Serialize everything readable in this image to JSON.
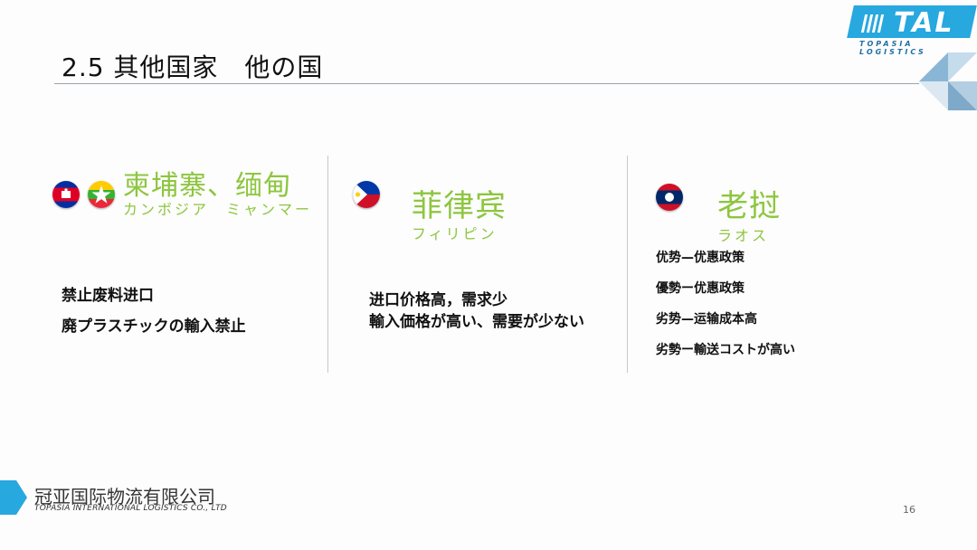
{
  "slide": {
    "title": "2.5 其他国家　他の国",
    "page_number": "16"
  },
  "logo": {
    "text": "TAL",
    "subtext": "TOPASIA LOGISTICS"
  },
  "columns": [
    {
      "heading_cn": "柬埔寨、缅甸",
      "heading_jp": "カンボジア　ミャンマー",
      "flags": [
        "cambodia-flag-icon",
        "myanmar-flag-icon"
      ],
      "lines": [
        "禁止废料进口",
        "廃プラスチックの輸入禁止"
      ]
    },
    {
      "heading_cn": "菲律宾",
      "heading_jp": "フィリピン",
      "flags": [
        "philippines-flag-icon"
      ],
      "lines": [
        "进口价格高，需求少",
        "輸入価格が高い、需要が少ない"
      ]
    },
    {
      "heading_cn": "老挝",
      "heading_jp": "ラオス",
      "flags": [
        "laos-flag-icon"
      ],
      "lines": [
        "优势—优惠政策",
        "優勢ー优惠政策",
        "劣势—运输成本高",
        "劣勢ー輸送コストが高い"
      ]
    }
  ],
  "footer": {
    "company_cn": "冠亚国际物流有限公司",
    "company_en": "TOPASIA INTERNATIONAL LOGISTICS CO., LTD"
  },
  "colors": {
    "accent_green": "#8dc63f",
    "brand_blue": "#27a8df"
  }
}
